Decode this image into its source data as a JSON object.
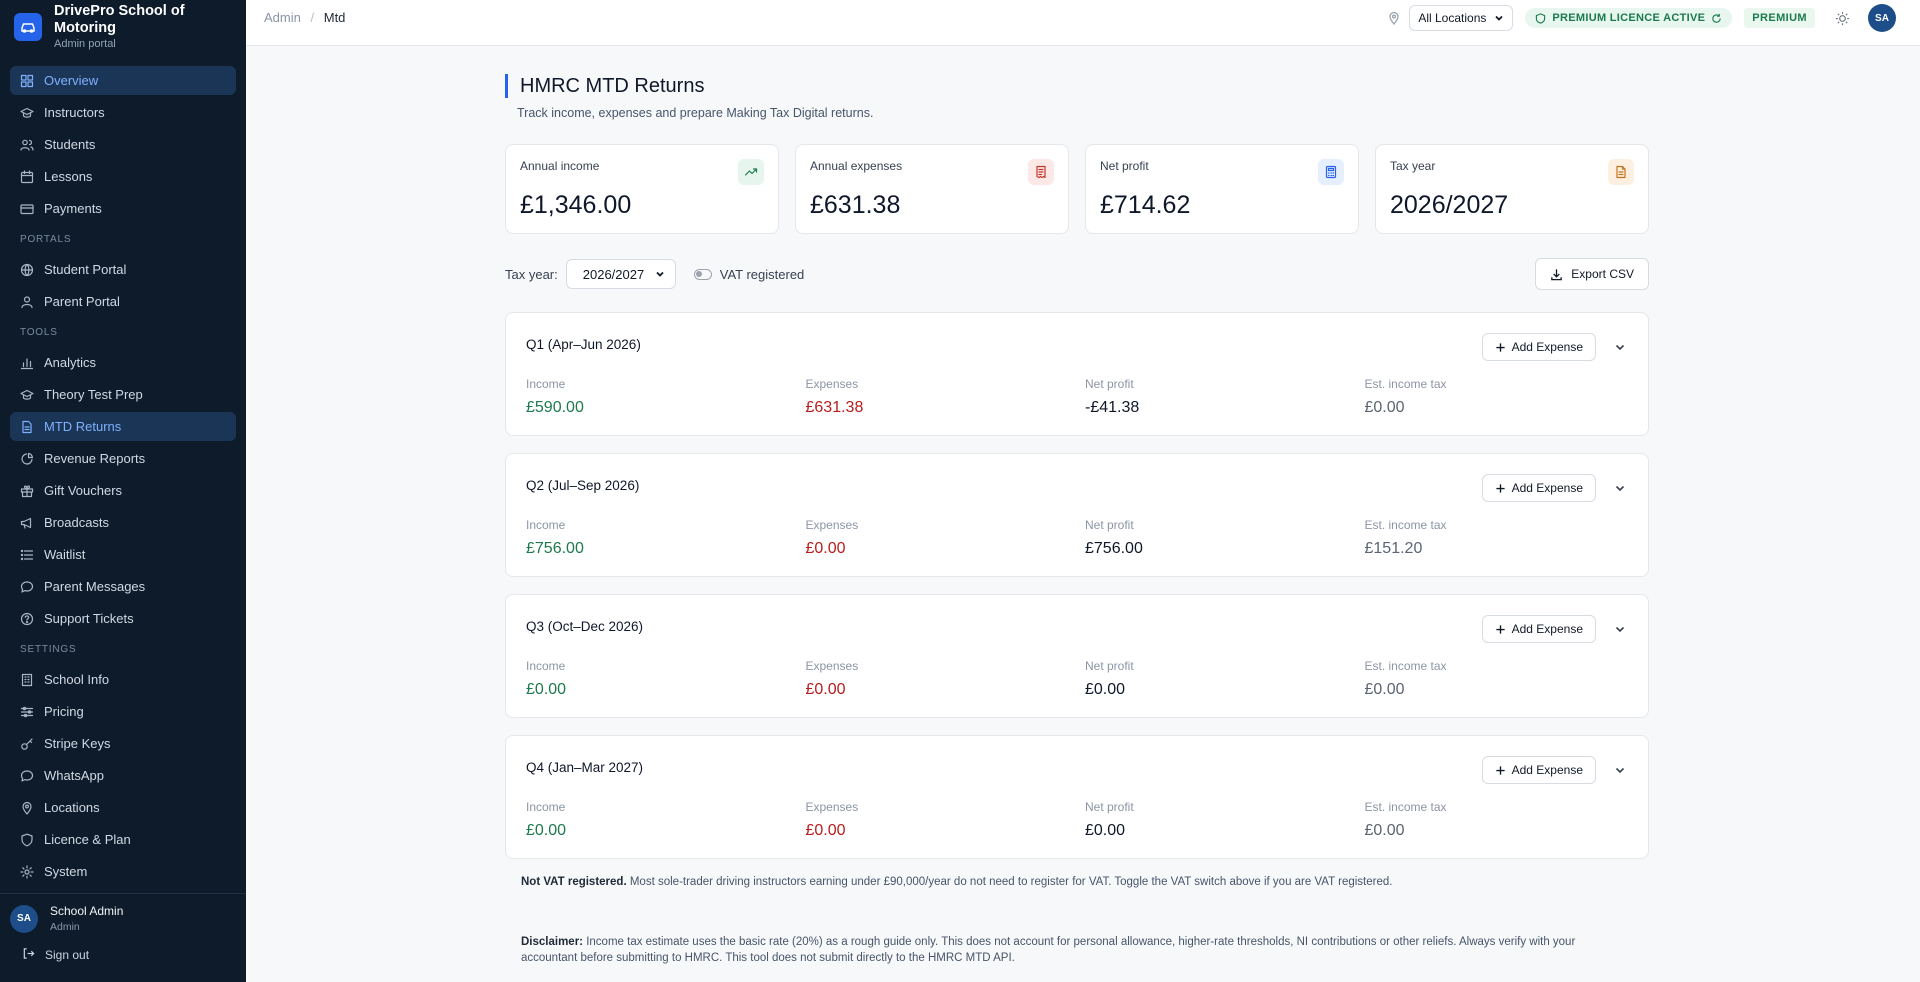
{
  "brand": {
    "title": "DrivePro School of Motoring",
    "subtitle": "Admin portal"
  },
  "nav": {
    "main": [
      {
        "label": "Overview",
        "icon": "grid-icon",
        "active": true
      },
      {
        "label": "Instructors",
        "icon": "graduation-cap-icon"
      },
      {
        "label": "Students",
        "icon": "users-icon"
      },
      {
        "label": "Lessons",
        "icon": "calendar-icon"
      },
      {
        "label": "Payments",
        "icon": "credit-card-icon"
      }
    ],
    "portals_heading": "PORTALS",
    "portals": [
      {
        "label": "Student Portal",
        "icon": "globe-icon"
      },
      {
        "label": "Parent Portal",
        "icon": "user-icon"
      }
    ],
    "tools_heading": "TOOLS",
    "tools": [
      {
        "label": "Analytics",
        "icon": "bar-chart-icon"
      },
      {
        "label": "Theory Test Prep",
        "icon": "graduation-cap-icon"
      },
      {
        "label": "MTD Returns",
        "icon": "file-icon",
        "active": true
      },
      {
        "label": "Revenue Reports",
        "icon": "pie-chart-icon"
      },
      {
        "label": "Gift Vouchers",
        "icon": "gift-icon"
      },
      {
        "label": "Broadcasts",
        "icon": "megaphone-icon"
      },
      {
        "label": "Waitlist",
        "icon": "list-icon"
      },
      {
        "label": "Parent Messages",
        "icon": "message-icon"
      },
      {
        "label": "Support Tickets",
        "icon": "help-circle-icon"
      }
    ],
    "settings_heading": "SETTINGS",
    "settings": [
      {
        "label": "School Info",
        "icon": "building-icon"
      },
      {
        "label": "Pricing",
        "icon": "sliders-icon"
      },
      {
        "label": "Stripe Keys",
        "icon": "key-icon"
      },
      {
        "label": "WhatsApp",
        "icon": "message-icon"
      },
      {
        "label": "Locations",
        "icon": "map-pin-icon"
      },
      {
        "label": "Licence & Plan",
        "icon": "shield-icon"
      },
      {
        "label": "System",
        "icon": "gear-icon"
      }
    ]
  },
  "user": {
    "initials": "SA",
    "name": "School Admin",
    "role": "Admin",
    "signout": "Sign out"
  },
  "topbar": {
    "breadcrumb": [
      "Admin",
      "Mtd"
    ],
    "location_select": "All Locations",
    "licence_badge": "PREMIUM LICENCE ACTIVE",
    "plan_badge": "PREMIUM",
    "avatar_initials": "SA"
  },
  "page": {
    "title": "HMRC MTD Returns",
    "description": "Track income, expenses and prepare Making Tax Digital returns."
  },
  "stats": [
    {
      "label": "Annual income",
      "value": "£1,346.00",
      "icon": "trending-up-icon",
      "icon_color": "#1c7a4d",
      "icon_bg": "#e6f5ee"
    },
    {
      "label": "Annual expenses",
      "value": "£631.38",
      "icon": "receipt-icon",
      "icon_color": "#c0392b",
      "icon_bg": "#fde8e8"
    },
    {
      "label": "Net profit",
      "value": "£714.62",
      "icon": "calculator-icon",
      "icon_color": "#2563eb",
      "icon_bg": "#e6efff"
    },
    {
      "label": "Tax year",
      "value": "2026/2027",
      "icon": "document-icon",
      "icon_color": "#c2741c",
      "icon_bg": "#fdf0e1"
    }
  ],
  "controls": {
    "tax_year_label": "Tax year:",
    "tax_year_value": "2026/2027",
    "vat_label": "VAT registered",
    "vat_on": false,
    "export_label": "Export CSV"
  },
  "quarter_labels": {
    "add_expense": "Add Expense",
    "income": "Income",
    "expenses": "Expenses",
    "net_profit": "Net profit",
    "est_tax": "Est. income tax"
  },
  "quarters": [
    {
      "title": "Q1 (Apr–Jun 2026)",
      "income": "£590.00",
      "expenses": "£631.38",
      "net": "-£41.38",
      "tax": "£0.00"
    },
    {
      "title": "Q2 (Jul–Sep 2026)",
      "income": "£756.00",
      "expenses": "£0.00",
      "net": "£756.00",
      "tax": "£151.20"
    },
    {
      "title": "Q3 (Oct–Dec 2026)",
      "income": "£0.00",
      "expenses": "£0.00",
      "net": "£0.00",
      "tax": "£0.00"
    },
    {
      "title": "Q4 (Jan–Mar 2027)",
      "income": "£0.00",
      "expenses": "£0.00",
      "net": "£0.00",
      "tax": "£0.00"
    }
  ],
  "notes": {
    "vat_strong": "Not VAT registered.",
    "vat_text": " Most sole-trader driving instructors earning under £90,000/year do not need to register for VAT. Toggle the VAT switch above if you are VAT registered.",
    "disclaimer_strong": "Disclaimer:",
    "disclaimer_text": " Income tax estimate uses the basic rate (20%) as a rough guide only. This does not account for personal allowance, higher-rate thresholds, NI contributions or other reliefs. Always verify with your accountant before submitting to HMRC. This tool does not submit directly to the HMRC MTD API."
  }
}
